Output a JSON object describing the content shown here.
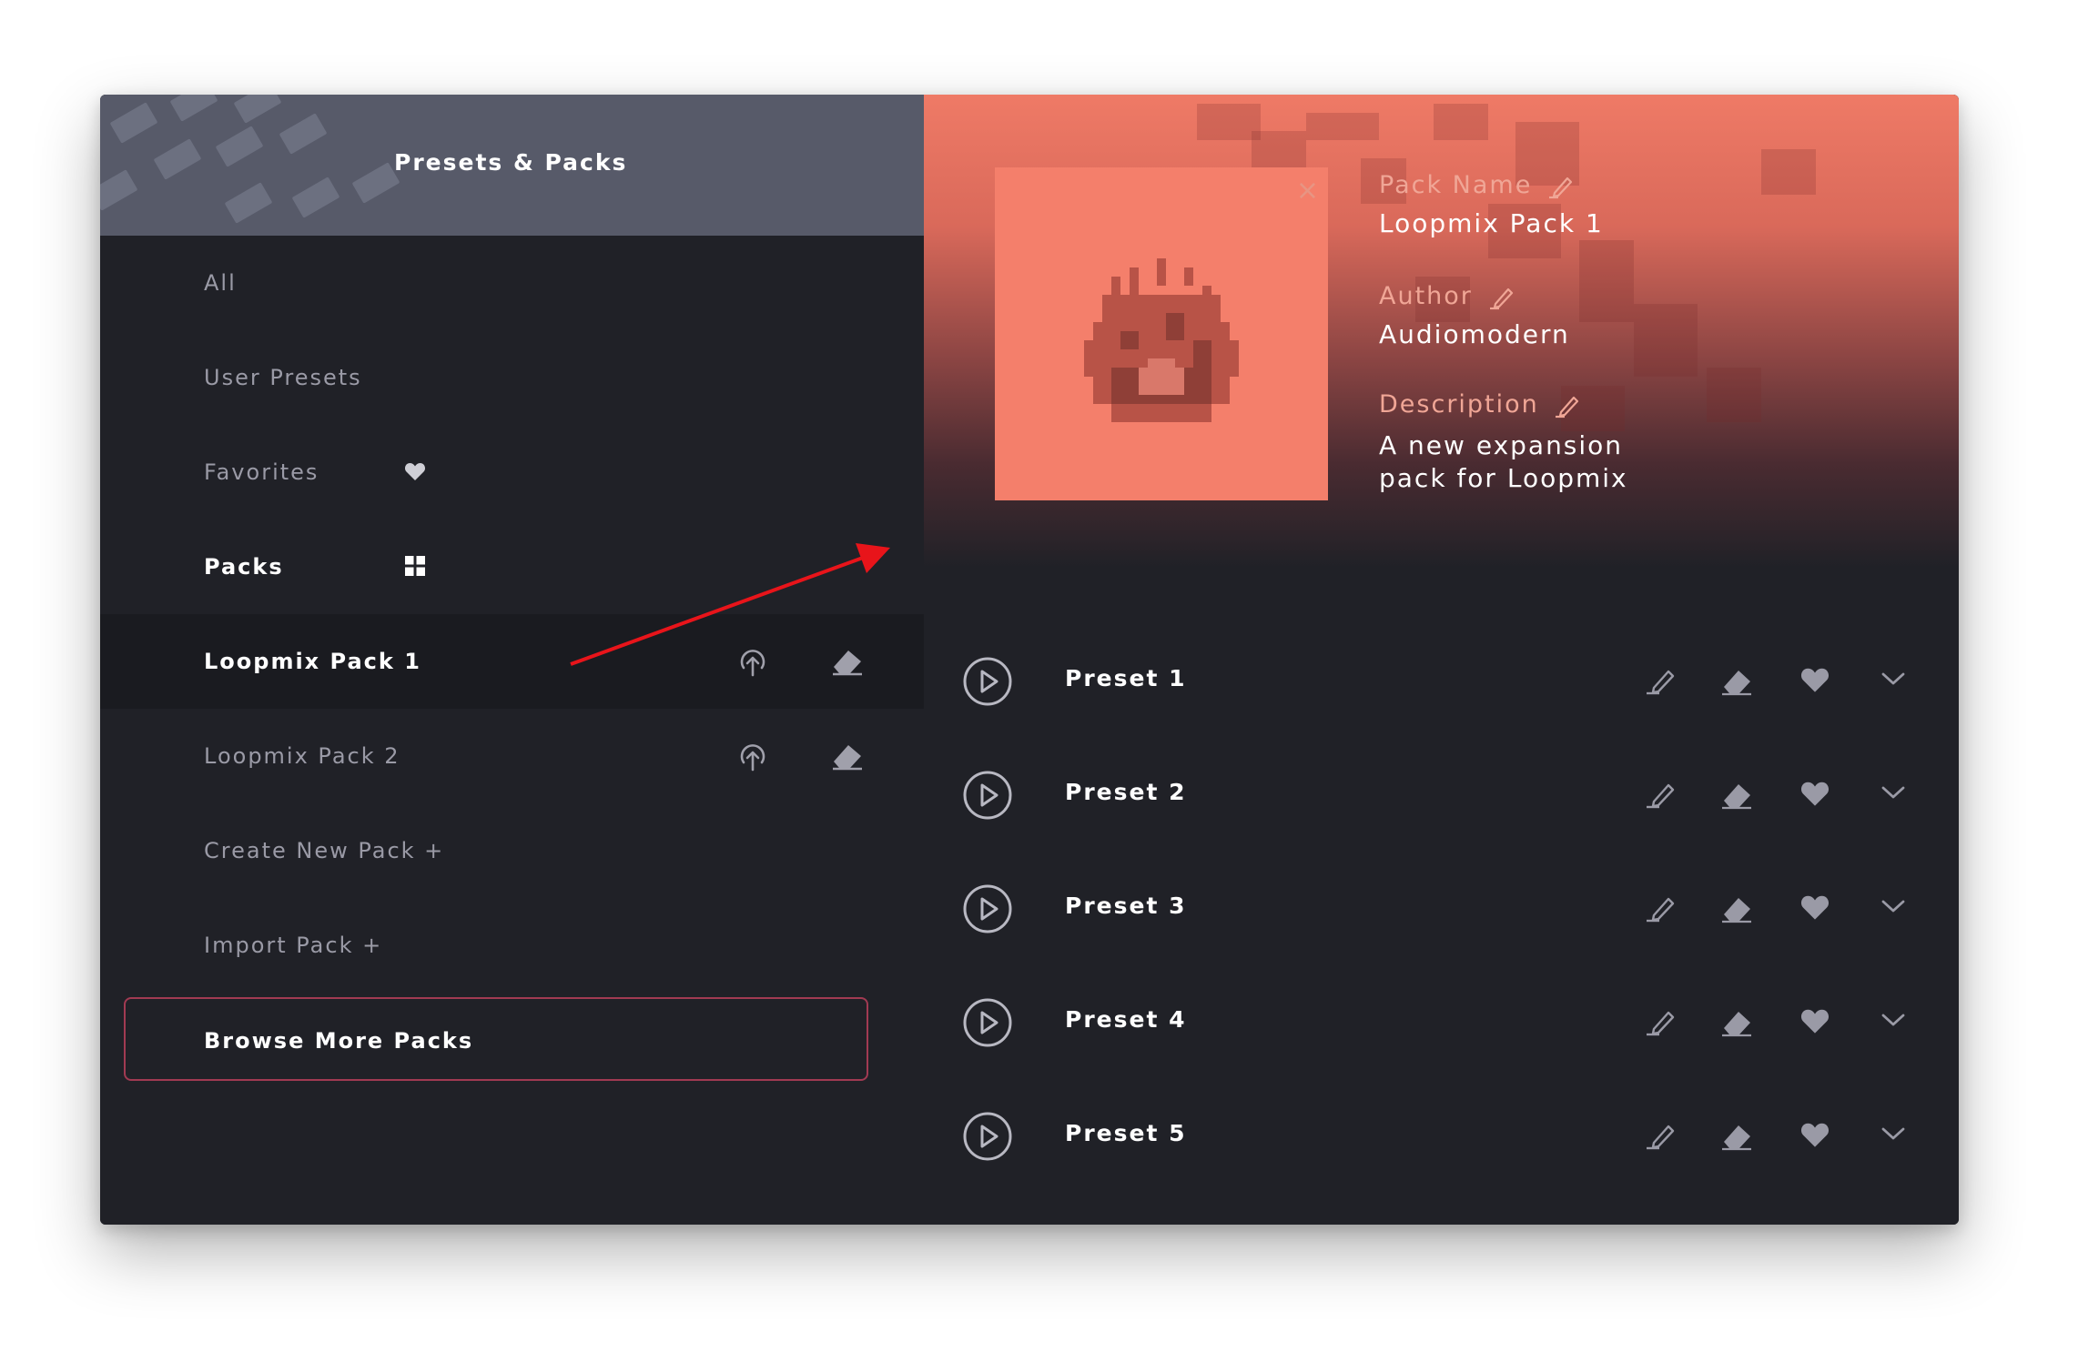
{
  "sidebar": {
    "title": "Presets & Packs",
    "items": [
      {
        "label": "All"
      },
      {
        "label": "User Presets"
      },
      {
        "label": "Favorites",
        "icon": "heart-icon"
      },
      {
        "label": "Packs",
        "icon": "grid-icon"
      },
      {
        "label": "Loopmix Pack 1",
        "icons": [
          "upload-icon",
          "eraser-icon"
        ]
      },
      {
        "label": "Loopmix Pack 2",
        "icons": [
          "upload-icon",
          "eraser-icon"
        ]
      },
      {
        "label": "Create New Pack +"
      },
      {
        "label": "Import Pack +"
      }
    ],
    "browse_label": "Browse More Packs"
  },
  "pack": {
    "close_symbol": "×",
    "cover_icon": "fire-icon",
    "name_label": "Pack Name",
    "name_value": "Loopmix Pack 1",
    "author_label": "Author",
    "author_value": "Audiomodern",
    "description_label": "Description",
    "description_line1": "A new expansion",
    "description_line2": "pack for Loopmix"
  },
  "presets": [
    {
      "name": "Preset 1"
    },
    {
      "name": "Preset 2"
    },
    {
      "name": "Preset 3"
    },
    {
      "name": "Preset 4"
    },
    {
      "name": "Preset 5"
    }
  ],
  "preset_actions": [
    "play-icon",
    "pencil-icon",
    "eraser-icon",
    "heart-icon",
    "chevron-down-icon"
  ],
  "colors": {
    "accent": "#f47f6b",
    "sidebar_header": "#575a69",
    "background": "#202127",
    "browse_border": "#a13a52",
    "annotation_arrow": "#e8141a"
  }
}
